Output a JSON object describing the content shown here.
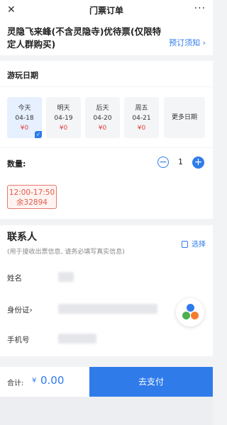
{
  "header": {
    "title": "门票订单",
    "close_icon": "close-icon",
    "more_icon": "more-icon",
    "more_glyph": "···"
  },
  "ticket": {
    "name": "灵隐飞来峰(不含灵隐寺)优待票(仅限特定人群购买)",
    "notice_label": "预订须知 ›"
  },
  "play_date": {
    "label": "游玩日期",
    "dates": [
      {
        "day": "今天",
        "date": "04-18",
        "price": "¥0",
        "selected": true
      },
      {
        "day": "明天",
        "date": "04-19",
        "price": "¥0",
        "selected": false
      },
      {
        "day": "后天",
        "date": "04-20",
        "price": "¥0",
        "selected": false
      },
      {
        "day": "周五",
        "date": "04-21",
        "price": "¥0",
        "selected": false
      }
    ],
    "more_label": "更多日期"
  },
  "quantity": {
    "label": "数量:",
    "value": "1",
    "minus": "−",
    "plus": "+"
  },
  "time_slot": {
    "time": "12:00-17:50",
    "remaining": "余32894"
  },
  "contact": {
    "heading": "联系人",
    "subtitle": "(用于接收出票信息, 请务必填写真实信息)",
    "choose_label": "选择",
    "fields": [
      {
        "label": "姓名"
      },
      {
        "label": "身份证›"
      },
      {
        "label": "手机号"
      }
    ]
  },
  "footer": {
    "total_label": "合计:",
    "currency": "¥",
    "amount": "0.00",
    "pay_label": "去支付"
  },
  "colors": {
    "accent": "#2f7bea",
    "price_red": "#e04040",
    "slot_red": "#e05a4a"
  }
}
